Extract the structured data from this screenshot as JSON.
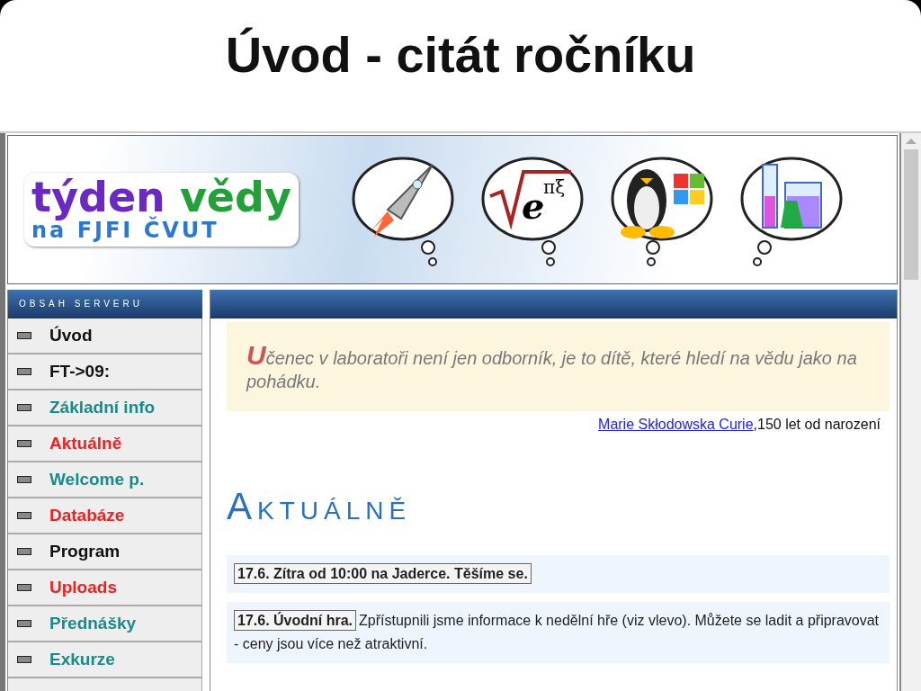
{
  "slide_title": "Úvod - citát ročníku",
  "banner": {
    "logo_line_1": "týden",
    "logo_line_1b": "vědy",
    "logo_line_2": "na FJFI ČVUT",
    "formula_base": "e",
    "formula_exponent": "πξ"
  },
  "sidebar": {
    "heading": "OBSAH SERVERU",
    "items": [
      {
        "label": "Úvod",
        "color": "#111111"
      },
      {
        "label": "FT->09:",
        "color": "#111111"
      },
      {
        "label": "Základní info",
        "color": "#1a8a8a"
      },
      {
        "label": "Aktuálně",
        "color": "#ee2222"
      },
      {
        "label": "Welcome p.",
        "color": "#1a8a8a"
      },
      {
        "label": "Databáze",
        "color": "#ee2222"
      },
      {
        "label": "Program",
        "color": "#111111"
      },
      {
        "label": "Uploads",
        "color": "#ee2222"
      },
      {
        "label": "Přednášky",
        "color": "#1a8a8a"
      },
      {
        "label": "Exkurze",
        "color": "#1a8a8a"
      }
    ]
  },
  "quote": {
    "initial": "U",
    "rest": "čenec v laboratoři není jen odborník, je to dítě, které hledí na vědu jako na pohádku.",
    "author_link": "Marie Skłodowska Curie",
    "author_note": ",150 let od narození"
  },
  "section_heading": "AKTUÁLNĚ",
  "news": [
    {
      "title": "17.6. Zítra od 10:00 na Jaderce. Těšíme se."
    },
    {
      "title": "17.6. Úvodní hra.",
      "text": "Zpřístupnili jsme informace k nedělní hře (viz vlevo). Můžete se ladit a připravovat - ceny jsou více než atraktivní."
    }
  ]
}
